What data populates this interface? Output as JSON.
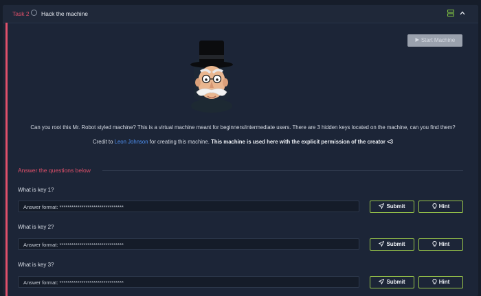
{
  "task": {
    "label": "Task 2",
    "title": "Hack the machine"
  },
  "start_button": "Start Machine",
  "description": "Can you root this Mr. Robot styled machine? This is a virtual machine meant for beginners/intermediate users. There are 3 hidden keys located on the machine, can you find them?",
  "credit": {
    "prefix": "Credit to ",
    "author": "Leon Johnson",
    "middle": " for creating this machine. ",
    "bold": "This machine is used here with the explicit permission of the creator <3"
  },
  "qa_title": "Answer the questions below",
  "questions": [
    {
      "label": "What is key 1?",
      "placeholder": "Answer format: ********************************",
      "submit": "Submit",
      "hint": "Hint"
    },
    {
      "label": "What is key 2?",
      "placeholder": "Answer format: ********************************",
      "submit": "Submit",
      "hint": "Hint"
    },
    {
      "label": "What is key 3?",
      "placeholder": "Answer format: ********************************",
      "submit": "Submit",
      "hint": "Hint"
    }
  ],
  "colors": {
    "accent": "#e0506a",
    "button_border": "#9bc84a",
    "link": "#4d8ff0"
  },
  "icons": {
    "layout": "split-layout-icon",
    "collapse": "chevron-up-icon",
    "submit": "send-icon",
    "hint": "lightbulb-icon",
    "play": "play-icon"
  }
}
